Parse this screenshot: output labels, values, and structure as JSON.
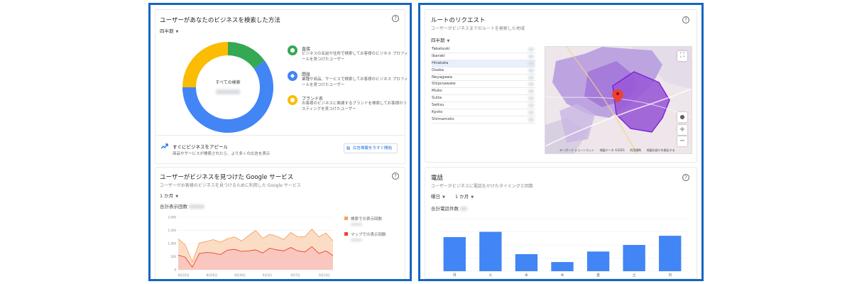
{
  "left": {
    "search": {
      "title": "ユーザーがあなたのビジネスを検索した方法",
      "period": "四半期",
      "help": "?",
      "donut_center": "すべての検索",
      "segments": [
        {
          "name": "直接",
          "value": 15,
          "color": "#34a853",
          "icon": "location-pin-icon",
          "glyph": "⬤",
          "desc": "ビジネスの名前や住所で検索してお客様のビジネス プロフィールを見つけたユーザー"
        },
        {
          "name": "間接",
          "value": 60,
          "color": "#4285f4",
          "icon": "category-icon",
          "glyph": "◆",
          "desc": "業種や商品、サービスで検索してお客様のビジネス プロフィールを見つけたユーザー"
        },
        {
          "name": "ブランド名",
          "value": 25,
          "color": "#fbbc04",
          "icon": "brand-icon",
          "glyph": "●",
          "desc": "お客様のビジネスに関連するブランドを検索してお客様のリスティングを見つけたユーザー"
        }
      ],
      "promo_title": "すぐにビジネスをアピール",
      "promo_desc": "商品やサービスが検索されたら、より多くの広告を表示",
      "promo_button": "広告掲載を今すぐ開始"
    },
    "services": {
      "title": "ユーザーがビジネスを見つけた Google サービス",
      "subtitle": "ユーザーがお客様のビジネスを見つけるために利用した Google サービス",
      "period": "1 か月",
      "total_label": "合計表示回数",
      "help": "?",
      "legend": [
        {
          "name": "検索での表示回数",
          "color": "#f6a05d"
        },
        {
          "name": "マップでの表示回数",
          "color": "#ea4335"
        }
      ],
      "yticks": [
        "2,000",
        "1,500",
        "1,000",
        "500",
        "0"
      ],
      "xticks": [
        "8月22日",
        "8月26日",
        "8月30日",
        "9月3日",
        "9月7日",
        "9月12日"
      ]
    }
  },
  "right": {
    "route": {
      "title": "ルートのリクエスト",
      "subtitle": "ユーザーがビジネスまでのルートを検索した地域",
      "period": "四半期",
      "help": "?",
      "cities": [
        "Takatsuki",
        "Ibaraki",
        "Hirakata",
        "Osaka",
        "Neyagawa",
        "Shijonawate",
        "Muko",
        "Suita",
        "Settsu",
        "Kyoto",
        "Shimamoto"
      ],
      "selected_city": "Hirakata",
      "map_attribution": [
        "キーボード ショートカット",
        "地図データ ©2021",
        "利用規約",
        "地図の誤りを報告する"
      ],
      "zoom_in": "+",
      "zoom_out": "−",
      "fullscreen": "⛶"
    },
    "calls": {
      "title": "電話",
      "subtitle": "ユーザーがビジネスに電話をかけたタイミングと回数",
      "filter_day": "曜日",
      "period": "1 か月",
      "total_label": "合計電話件数",
      "help": "?"
    }
  },
  "chart_data": [
    {
      "type": "pie",
      "title": "ユーザーがあなたのビジネスを検索した方法",
      "categories": [
        "直接",
        "間接",
        "ブランド名"
      ],
      "values": [
        15,
        60,
        25
      ]
    },
    {
      "type": "area",
      "title": "ユーザーがビジネスを見つけた Google サービス",
      "ylim": [
        0,
        2000
      ],
      "x": [
        "8月22日",
        "8月23日",
        "8月24日",
        "8月25日",
        "8月26日",
        "8月27日",
        "8月28日",
        "8月29日",
        "8月30日",
        "8月31日",
        "9月1日",
        "9月2日",
        "9月3日",
        "9月4日",
        "9月5日",
        "9月6日",
        "9月7日",
        "9月8日",
        "9月9日",
        "9月10日",
        "9月11日",
        "9月12日",
        "9月13日"
      ],
      "series": [
        {
          "name": "検索での表示回数",
          "values": [
            1180,
            950,
            300,
            1020,
            1080,
            1150,
            1050,
            1180,
            1250,
            1100,
            1300,
            1500,
            1200,
            1350,
            1280,
            1150,
            1420,
            1250,
            1260,
            1550,
            1250,
            1400,
            1100
          ]
        },
        {
          "name": "マップでの表示回数",
          "values": [
            560,
            480,
            100,
            620,
            660,
            640,
            580,
            750,
            780,
            700,
            720,
            760,
            640,
            820,
            760,
            720,
            850,
            720,
            680,
            880,
            620,
            720,
            540
          ]
        }
      ]
    },
    {
      "type": "bar",
      "title": "電話",
      "categories": [
        "月",
        "火",
        "水",
        "木",
        "金",
        "土",
        "日"
      ],
      "values": [
        13,
        15,
        6.5,
        3.5,
        7.5,
        10,
        13.5
      ],
      "ylim": [
        0,
        20
      ]
    }
  ]
}
